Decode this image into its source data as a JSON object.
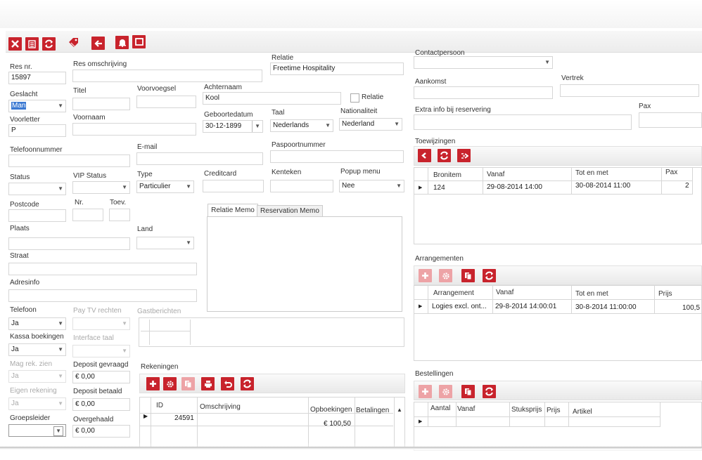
{
  "toolbar": {
    "icons": [
      "close-icon",
      "save-icon",
      "refresh-icon",
      "tag-icon",
      "back-icon",
      "bell-icon",
      "window-icon"
    ]
  },
  "form": {
    "res_nr": {
      "label": "Res nr.",
      "value": "15897"
    },
    "res_omschrijving": {
      "label": "Res omschrijving",
      "value": ""
    },
    "relatie": {
      "label": "Relatie",
      "value": "Freetime Hospitality"
    },
    "geslacht": {
      "label": "Geslacht",
      "value": "Man"
    },
    "titel": {
      "label": "Titel",
      "value": ""
    },
    "voorvoegsel": {
      "label": "Voorvoegsel",
      "value": ""
    },
    "achternaam": {
      "label": "Achternaam",
      "value": "Kool"
    },
    "relatie_check": {
      "label": "Relatie"
    },
    "voorletter": {
      "label": "Voorletter",
      "value": "P"
    },
    "voornaam": {
      "label": "Voornaam",
      "value": ""
    },
    "geboortedatum": {
      "label": "Geboortedatum",
      "value": "30-12-1899"
    },
    "taal": {
      "label": "Taal",
      "value": "Nederlands"
    },
    "nationaliteit": {
      "label": "Nationaliteit",
      "value": "Nederland"
    },
    "telefoonnummer": {
      "label": "Telefoonnummer",
      "value": ""
    },
    "email": {
      "label": "E-mail",
      "value": ""
    },
    "paspoortnummer": {
      "label": "Paspoortnummer",
      "value": ""
    },
    "status": {
      "label": "Status",
      "value": ""
    },
    "vip_status": {
      "label": "VIP Status",
      "value": ""
    },
    "type": {
      "label": "Type",
      "value": "Particulier"
    },
    "creditcard": {
      "label": "Creditcard",
      "value": ""
    },
    "kenteken": {
      "label": "Kenteken",
      "value": ""
    },
    "popup_menu": {
      "label": "Popup menu",
      "value": "Nee"
    },
    "postcode": {
      "label": "Postcode",
      "value": ""
    },
    "nr": {
      "label": "Nr.",
      "value": ""
    },
    "toev": {
      "label": "Toev.",
      "value": ""
    },
    "plaats": {
      "label": "Plaats",
      "value": ""
    },
    "land": {
      "label": "Land",
      "value": ""
    },
    "straat": {
      "label": "Straat",
      "value": ""
    },
    "adresinfo": {
      "label": "Adresinfo",
      "value": ""
    },
    "telefoon": {
      "label": "Telefoon",
      "value": "Ja"
    },
    "pay_tv": {
      "label": "Pay TV rechten",
      "value": ""
    },
    "gastberichten": {
      "label": "Gastberichten"
    },
    "kassa_boekingen": {
      "label": "Kassa boekingen",
      "value": "Ja"
    },
    "interface_taal": {
      "label": "Interface taal",
      "value": ""
    },
    "mag_rek_zien": {
      "label": "Mag rek. zien",
      "value": "Ja"
    },
    "deposit_gevraagd": {
      "label": "Deposit gevraagd",
      "value": "€ 0,00"
    },
    "eigen_rekening": {
      "label": "Eigen rekening",
      "value": "Ja"
    },
    "deposit_betaald": {
      "label": "Deposit betaald",
      "value": "€ 0,00"
    },
    "kassa_rek": {
      "value": "Ja"
    },
    "kassa_rek_amount": {
      "value": "€ 0,00"
    },
    "groepsleider": {
      "label": "Groepsleider",
      "value": ""
    },
    "overgehaald": {
      "label": "Overgehaald",
      "value": "€ 0,00"
    }
  },
  "memo_tabs": [
    "Relatie Memo",
    "Reservation Memo"
  ],
  "rekeningen": {
    "title": "Rekeningen",
    "columns": [
      "ID",
      "Omschrijving",
      "Opboekingen",
      "Betalingen"
    ],
    "rows": [
      {
        "id": "24591",
        "omschrijving": "",
        "opboekingen": "€ 100,50",
        "betalingen": ""
      }
    ]
  },
  "right": {
    "contactpersoon": {
      "label": "Contactpersoon",
      "value": ""
    },
    "aankomst": {
      "label": "Aankomst",
      "value": ""
    },
    "vertrek": {
      "label": "Vertrek",
      "value": ""
    },
    "extra_info": {
      "label": "Extra info bij reservering",
      "value": ""
    },
    "pax": {
      "label": "Pax",
      "value": ""
    }
  },
  "toewijzingen": {
    "title": "Toewijzingen",
    "columns": [
      "Bronitem",
      "Vanaf",
      "Tot en met",
      "Pax"
    ],
    "rows": [
      {
        "bronitem": "124",
        "vanaf": "29-08-2014 14:00",
        "tot": "30-08-2014 11:00",
        "pax": "2"
      }
    ]
  },
  "arrangementen": {
    "title": "Arrangementen",
    "columns": [
      "Arrangement",
      "Vanaf",
      "Tot en met",
      "Prijs"
    ],
    "rows": [
      {
        "arrangement": "Logies excl. ont...",
        "vanaf": "29-8-2014 14:00:01",
        "tot": "30-8-2014 11:00:00",
        "prijs": "100,5"
      }
    ]
  },
  "bestellingen": {
    "title": "Bestellingen",
    "columns": [
      "Aantal",
      "Vanaf",
      "Stuksprijs",
      "Prijs",
      "Artikel"
    ]
  },
  "colors": {
    "accent": "#c8232c",
    "accent_pale": "#eda3a6",
    "border": "#d6d6d6"
  }
}
